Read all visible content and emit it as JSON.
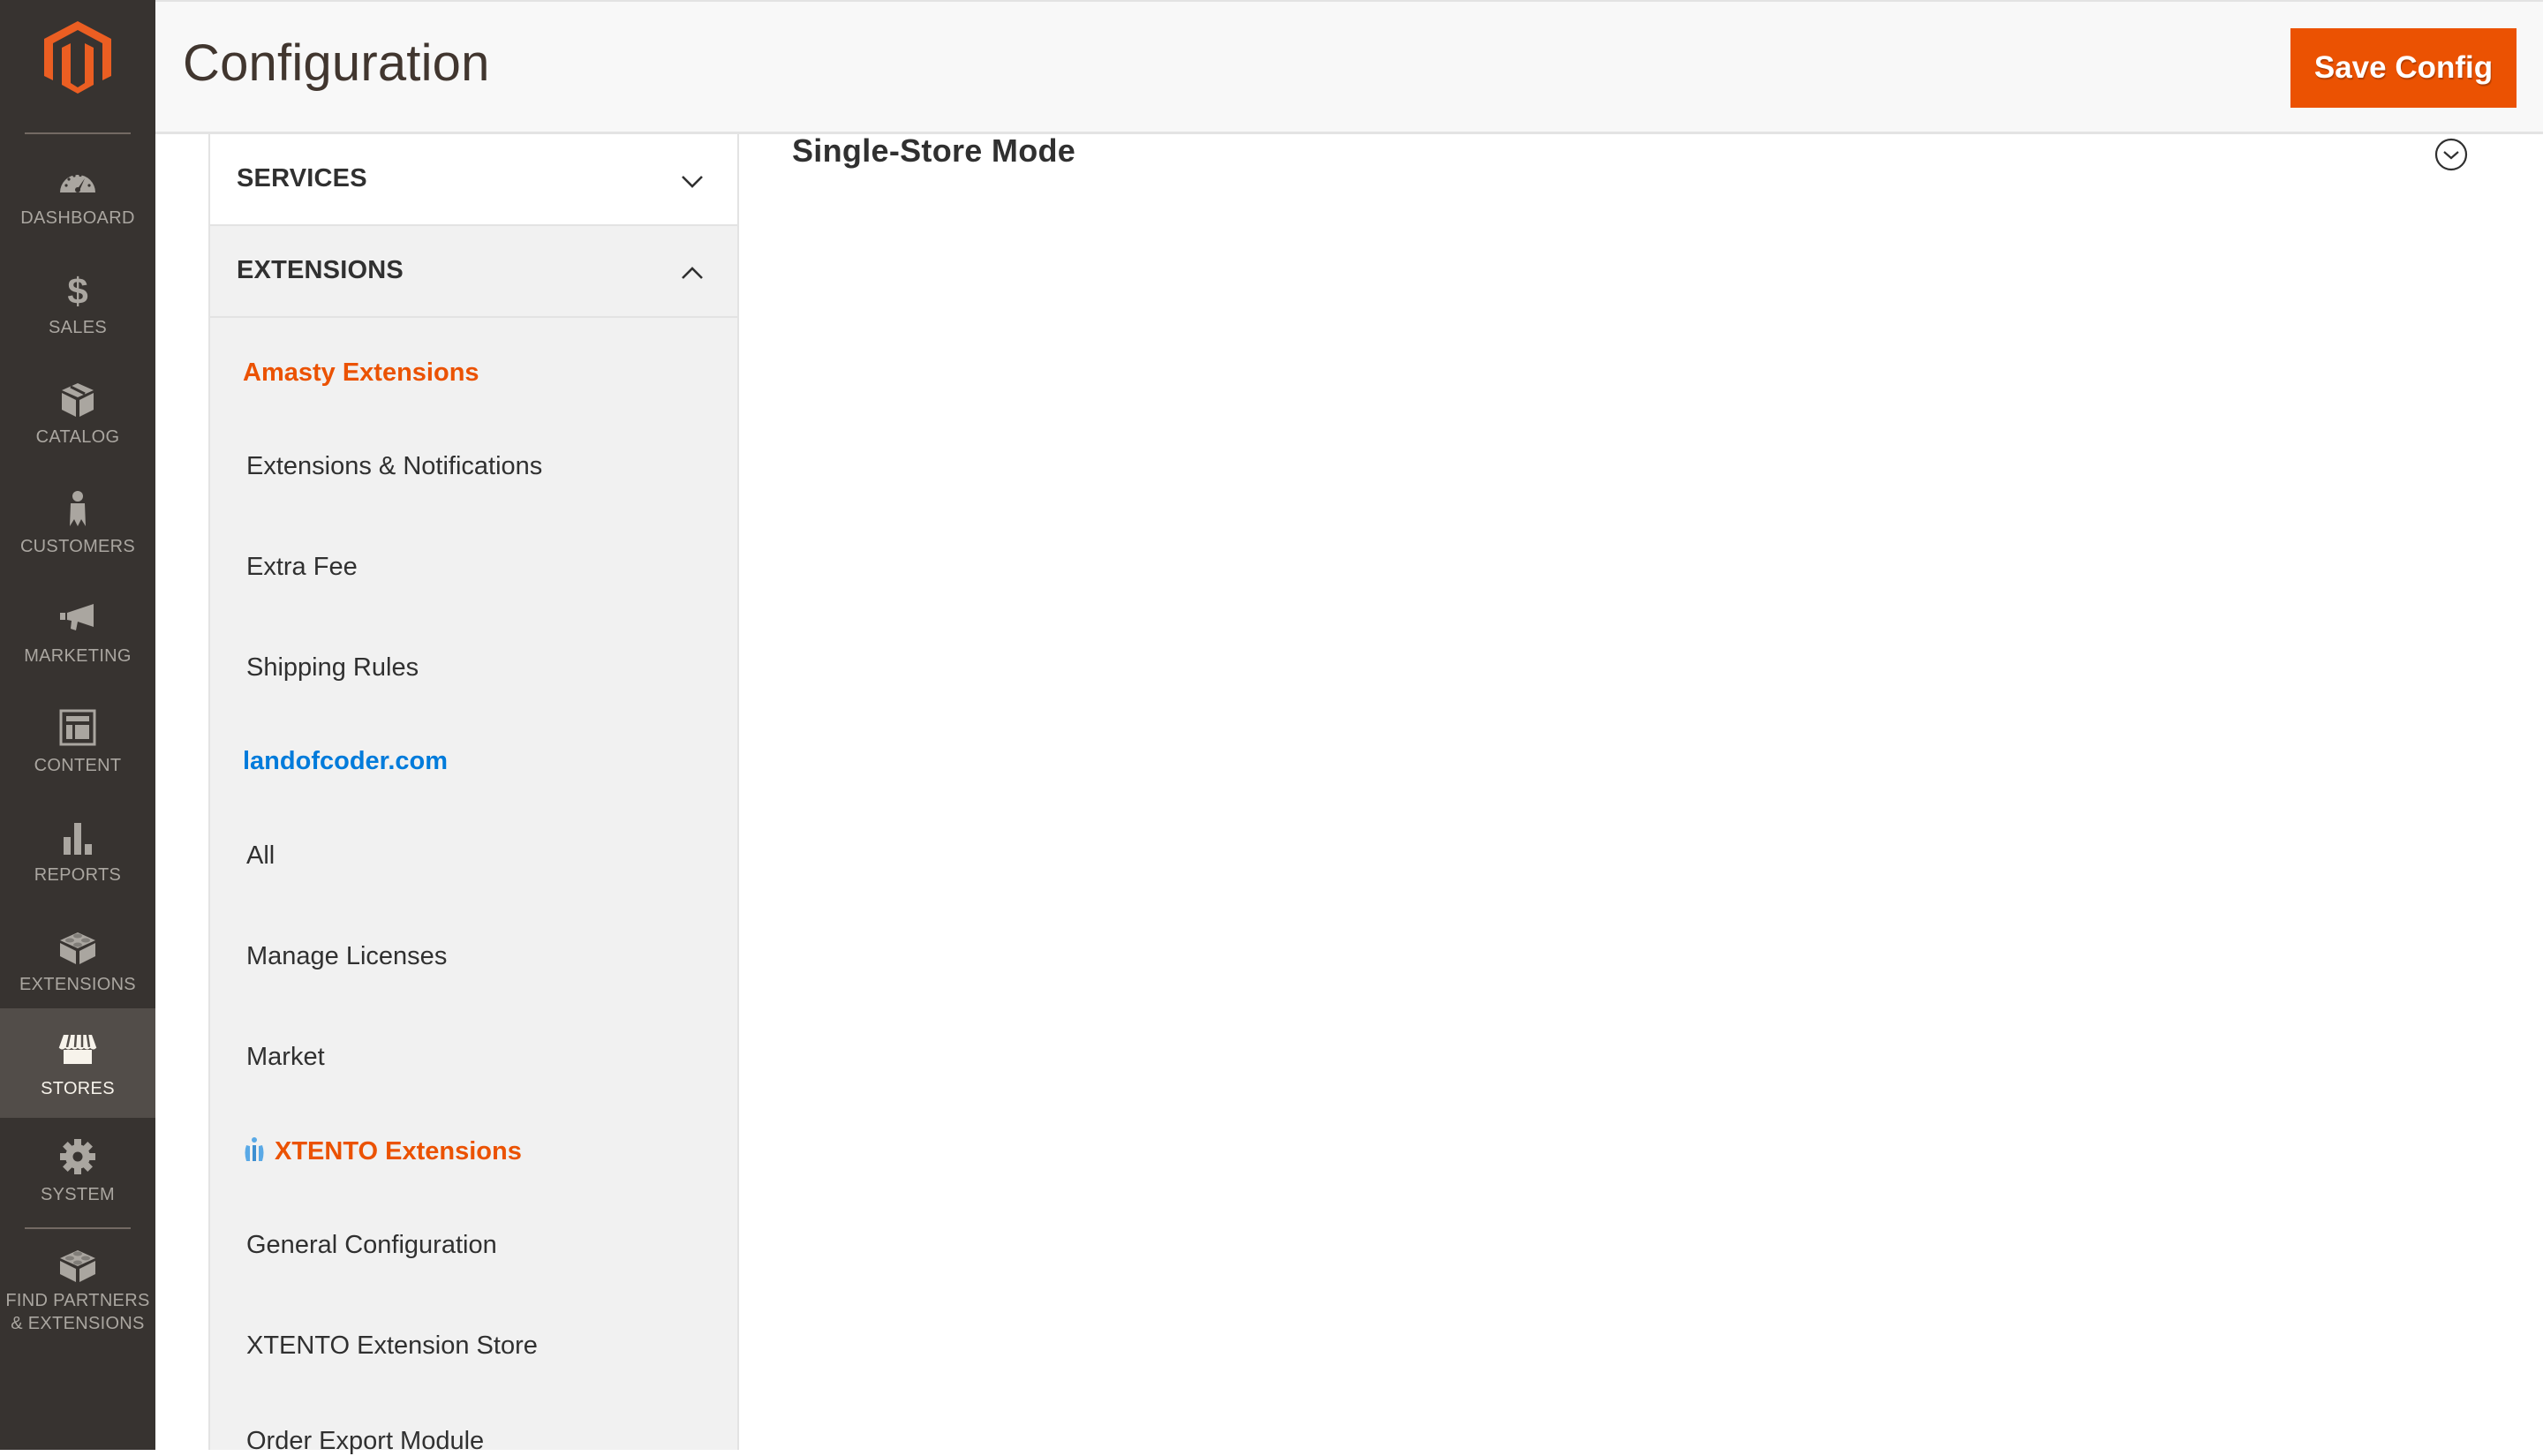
{
  "admin_nav": {
    "logo": "magento-logo",
    "items": [
      {
        "label": "DASHBOARD",
        "icon": "dashboard-gauge-icon",
        "active": false
      },
      {
        "label": "SALES",
        "icon": "dollar-icon",
        "active": false
      },
      {
        "label": "CATALOG",
        "icon": "box-icon",
        "active": false
      },
      {
        "label": "CUSTOMERS",
        "icon": "person-icon",
        "active": false
      },
      {
        "label": "MARKETING",
        "icon": "megaphone-icon",
        "active": false
      },
      {
        "label": "CONTENT",
        "icon": "layout-icon",
        "active": false
      },
      {
        "label": "REPORTS",
        "icon": "bar-chart-icon",
        "active": false
      },
      {
        "label": "EXTENSIONS",
        "icon": "lego-brick-icon",
        "active": false
      },
      {
        "label": "STORES",
        "icon": "storefront-icon",
        "active": true
      },
      {
        "label": "SYSTEM",
        "icon": "gear-icon",
        "active": false
      },
      {
        "label_line1": "FIND PARTNERS",
        "label_line2": "& EXTENSIONS",
        "icon": "lego-brick-icon",
        "active": false
      }
    ]
  },
  "header": {
    "title": "Configuration",
    "save_label": "Save Config"
  },
  "config_nav": {
    "sections": [
      {
        "title": "SERVICES",
        "state": "collapsed",
        "icon": "chevron-down-icon"
      },
      {
        "title": "EXTENSIONS",
        "state": "expanded",
        "icon": "chevron-up-icon"
      }
    ],
    "groups": [
      {
        "title": "Amasty Extensions",
        "color": "#eb5202",
        "items": [
          "Extensions & Notifications",
          "Extra Fee",
          "Shipping Rules"
        ]
      },
      {
        "title": "landofcoder.com",
        "color": "#007bdb",
        "items": [
          "All",
          "Manage Licenses",
          "Market"
        ]
      },
      {
        "title": "XTENTO Extensions",
        "color": "#eb5202",
        "icon": "xtento-logo-icon",
        "items": [
          "General Configuration",
          "XTENTO Extension Store",
          "Order Export Module"
        ]
      }
    ]
  },
  "main": {
    "section_title": "Single-Store Mode",
    "section_toggle_icon": "circle-chevron-down-icon"
  },
  "colors": {
    "nav_bg": "#373330",
    "nav_active_bg": "#524d49",
    "accent_orange": "#eb5202",
    "link_blue": "#007bdb"
  }
}
